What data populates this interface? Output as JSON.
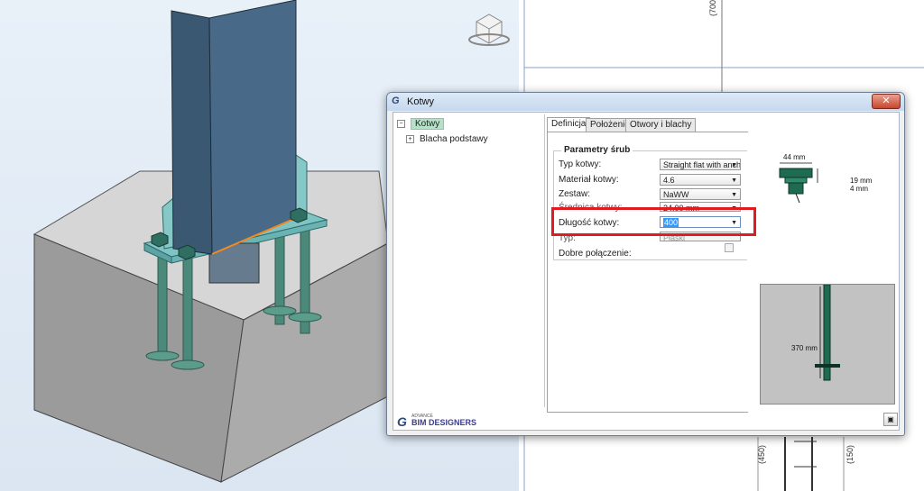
{
  "drawing": {
    "dim_top": "(700)",
    "dim_left": "(450)",
    "dim_right": "(150)"
  },
  "dialog": {
    "title_logo": "G",
    "title": "Kotwy",
    "close_symbol": "✕",
    "tree": {
      "root": "Kotwy",
      "child": "Blacha podstawy",
      "root_expander": "−",
      "child_expander": "+"
    },
    "tabs": [
      "Definicja",
      "Położenie",
      "Otwory i blachy"
    ],
    "group_title": "Parametry śrub",
    "properties": [
      {
        "label": "Typ kotwy:",
        "value": "Straight flat with anch"
      },
      {
        "label": "Materiał kotwy:",
        "value": "4.6"
      },
      {
        "label": "Zestaw:",
        "value": "NaWW"
      },
      {
        "label": "Średnica kotwy:",
        "value": "24.00 mm"
      },
      {
        "label": "Długość kotwy:",
        "value": "400"
      },
      {
        "label": "Typ:",
        "value": "Płaski"
      },
      {
        "label": "Dobre połączenie:",
        "value": ""
      }
    ],
    "arrow": "▼",
    "bolt_dims": {
      "width": "44 mm",
      "height1": "19 mm",
      "height2": "4 mm"
    },
    "anchor_length": "370 mm",
    "brand": {
      "logo": "G",
      "small": "ADVANCE",
      "name": "BIM DESIGNERS"
    },
    "corner_icon": "▣"
  },
  "colors": {
    "highlight": "#e01b22",
    "steel": "#3b5873",
    "plate": "#7ec4c4",
    "anchor": "#1f6b52"
  }
}
